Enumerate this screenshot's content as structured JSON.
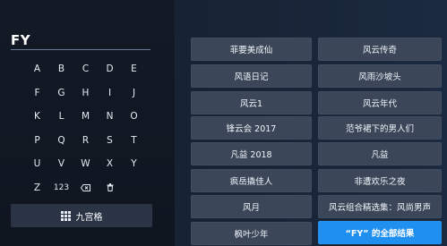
{
  "search": {
    "query": "FY"
  },
  "keyboard": {
    "keys": [
      "A",
      "B",
      "C",
      "D",
      "E",
      "F",
      "G",
      "H",
      "I",
      "J",
      "K",
      "L",
      "M",
      "N",
      "O",
      "P",
      "Q",
      "R",
      "S",
      "T",
      "U",
      "V",
      "W",
      "X",
      "Y",
      "Z",
      "123",
      "backspace-icon",
      "trash-icon"
    ],
    "row6": [
      "Z",
      "123"
    ]
  },
  "nine_grid_button": {
    "label": "九宫格"
  },
  "results": {
    "left": [
      "菲要美成仙",
      "风语日记",
      "风云1",
      "锋云会 2017",
      "凡益 2018",
      "疯岳撬佳人",
      "风月",
      "枫叶少年"
    ],
    "right": [
      "风云传奇",
      "风雨沙坡头",
      "风云年代",
      "范爷裙下的男人们",
      "凡益",
      "非遭欢乐之夜",
      "风云组合精选集：风尚男声"
    ],
    "all_results": "“FY” 的全部结果"
  },
  "colors": {
    "accent": "#1f8ff0",
    "button": "#3b4759",
    "background": "#172232"
  }
}
